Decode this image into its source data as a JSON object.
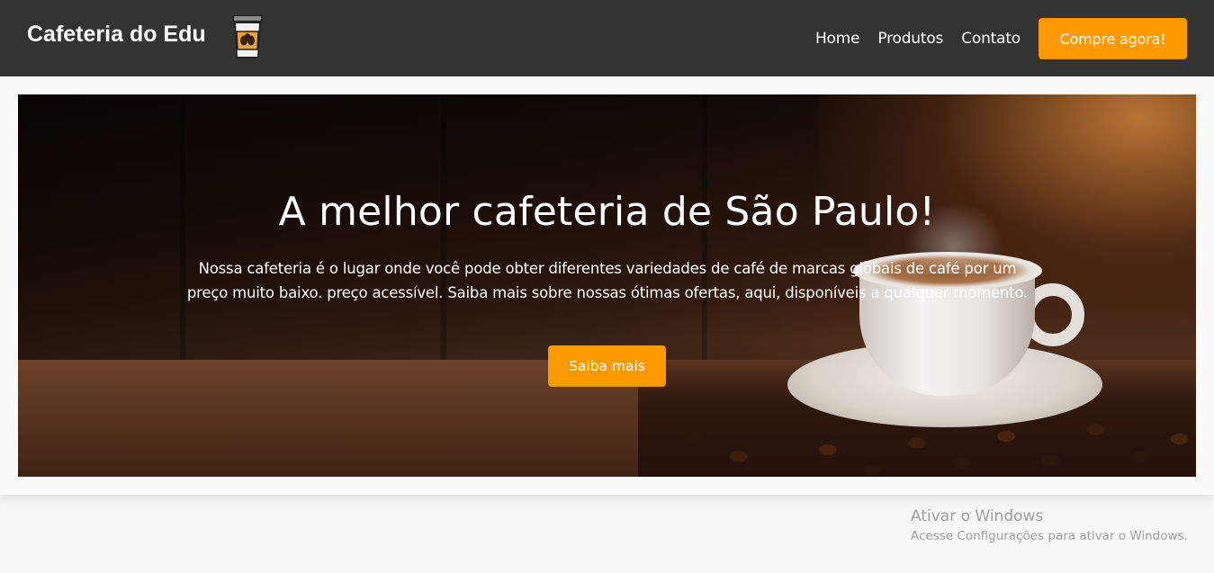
{
  "header": {
    "brand": "Cafeteria do Edu",
    "logo_icon": "coffee-cup-icon",
    "nav": [
      {
        "label": "Home"
      },
      {
        "label": "Produtos"
      },
      {
        "label": "Contato"
      }
    ],
    "cta_label": "Compre agora!"
  },
  "hero": {
    "title": "A melhor cafeteria de São Paulo!",
    "text": "Nossa cafeteria é o lugar onde você pode obter diferentes variedades de café de marcas globais de café por um preço muito baixo. preço acessível. Saiba mais sobre nossas ótimas ofertas, aqui, disponíveis a qualquer momento.",
    "button_label": "Saiba mais"
  },
  "watermark": {
    "title": "Ativar o Windows",
    "subtitle": "Acesse Configurações para ativar o Windows."
  },
  "colors": {
    "navbar": "#333333",
    "accent": "#ff9900",
    "page_bg": "#f7f7f7"
  }
}
